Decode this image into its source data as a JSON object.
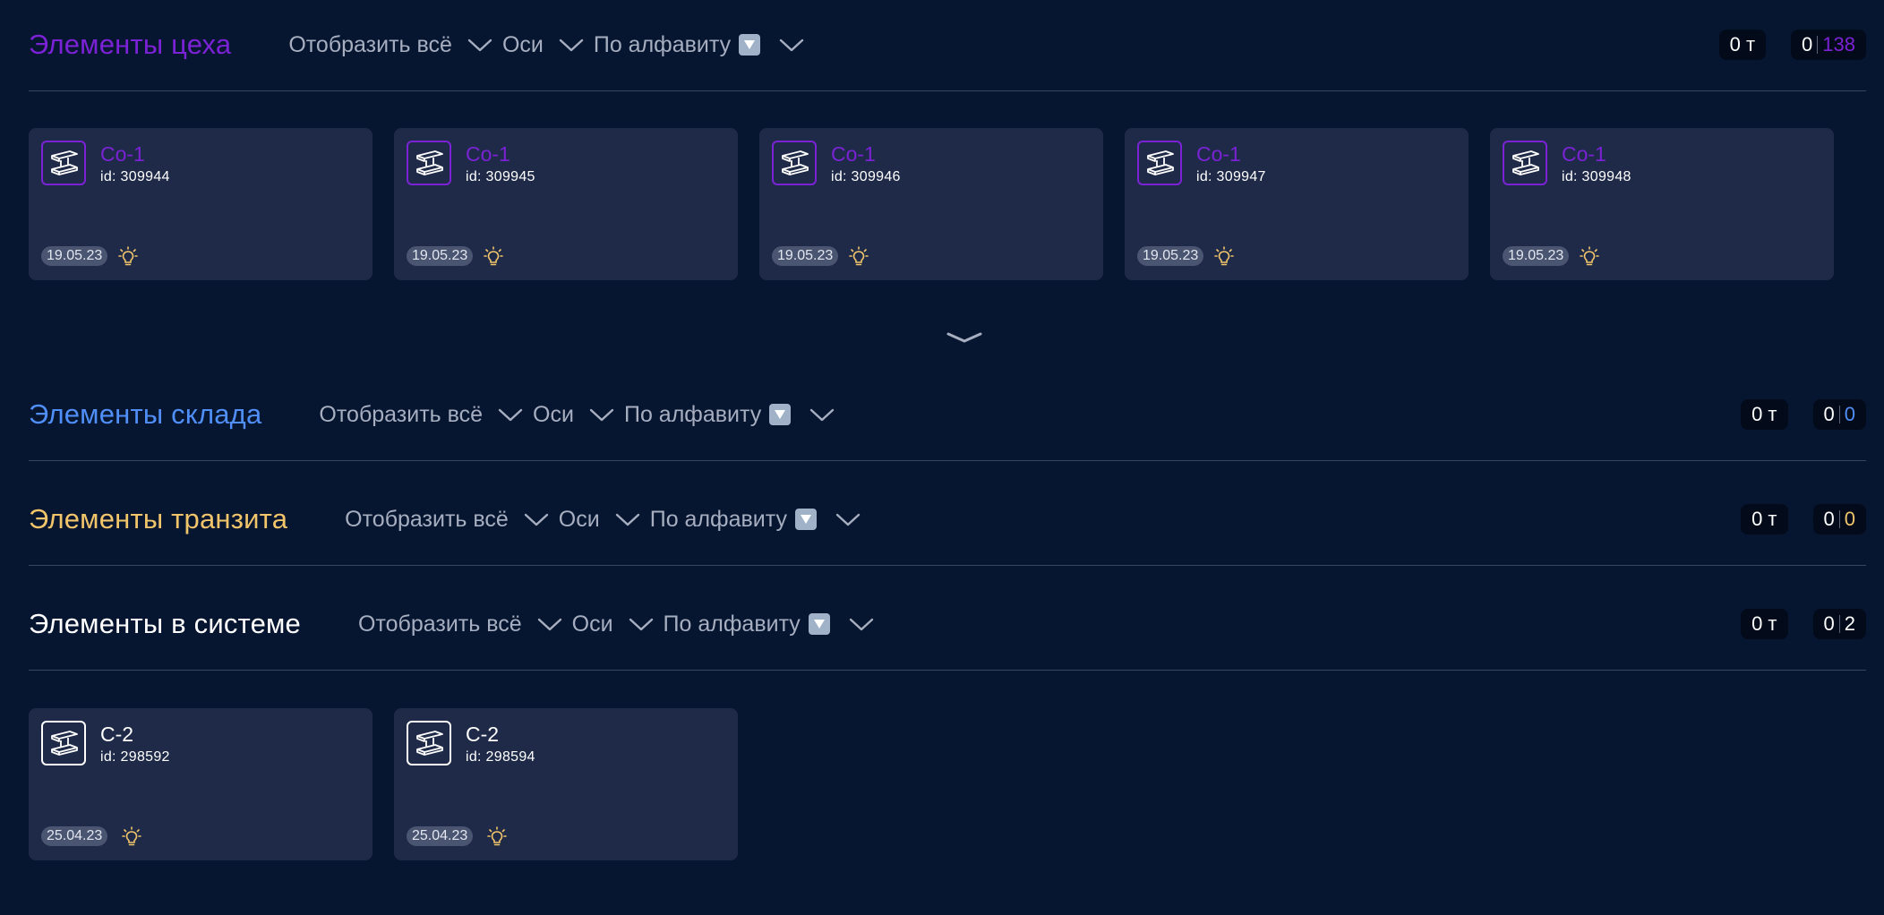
{
  "sections": {
    "workshop": {
      "title": "Элементы цеха",
      "title_color": "#7c22d6",
      "controls": {
        "display_all": "Отобразить всё",
        "axes": "Оси",
        "sort": "По алфавиту"
      },
      "weight": "0 т",
      "count_left": "0",
      "count_right": "138",
      "count_color": "#7c22d6",
      "cards": [
        {
          "name": "Со-1",
          "id": "id: 309944",
          "date": "19.05.23"
        },
        {
          "name": "Со-1",
          "id": "id: 309945",
          "date": "19.05.23"
        },
        {
          "name": "Со-1",
          "id": "id: 309946",
          "date": "19.05.23"
        },
        {
          "name": "Со-1",
          "id": "id: 309947",
          "date": "19.05.23"
        },
        {
          "name": "Со-1",
          "id": "id: 309948",
          "date": "19.05.23"
        }
      ]
    },
    "warehouse": {
      "title": "Элементы склада",
      "title_color": "#4f8ff7",
      "controls": {
        "display_all": "Отобразить всё",
        "axes": "Оси",
        "sort": "По алфавиту"
      },
      "weight": "0 т",
      "count_left": "0",
      "count_right": "0",
      "count_color": "#4f8ff7"
    },
    "transit": {
      "title": "Элементы транзита",
      "title_color": "#f2c56a",
      "controls": {
        "display_all": "Отобразить всё",
        "axes": "Оси",
        "sort": "По алфавиту"
      },
      "weight": "0 т",
      "count_left": "0",
      "count_right": "0",
      "count_color": "#f2c56a"
    },
    "system": {
      "title": "Элементы в системе",
      "title_color": "#ffffff",
      "controls": {
        "display_all": "Отобразить всё",
        "axes": "Оси",
        "sort": "По алфавиту"
      },
      "weight": "0 т",
      "count_left": "0",
      "count_right": "2",
      "count_color": "#ffffff",
      "cards": [
        {
          "name": "С-2",
          "id": "id: 298592",
          "date": "25.04.23"
        },
        {
          "name": "С-2",
          "id": "id: 298594",
          "date": "25.04.23"
        }
      ]
    }
  },
  "icons": {
    "card_icon": "steel-beam-icon",
    "status_icon": "lightbulb-icon",
    "dropdown_icon": "chevron-down-icon",
    "sort_icon": "down-arrow-button-emoji",
    "expand_icon": "expand-chevron-icon"
  },
  "colors": {
    "background": "#061530",
    "card_background": "#1f2a48",
    "bulb": "#f2c56a"
  }
}
